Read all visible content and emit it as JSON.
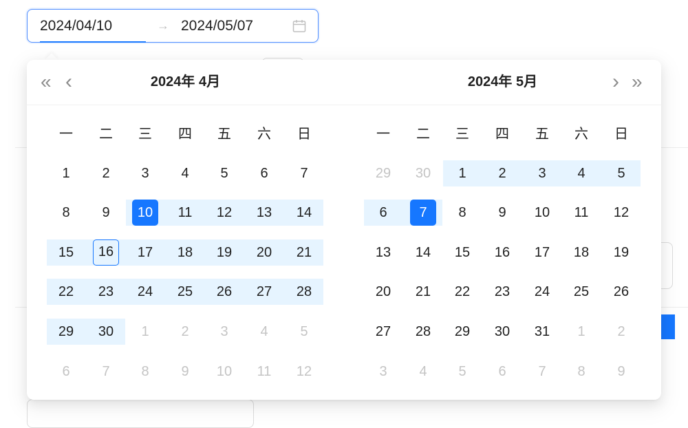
{
  "range": {
    "start": "2024/04/10",
    "separator": "→",
    "end": "2024/05/07"
  },
  "colors": {
    "accent": "#1677ff",
    "range_band": "#e6f4ff",
    "muted": "#c4c4c4"
  },
  "icons": {
    "calendar": "calendar-icon",
    "super_prev": "double-chevron-left-icon",
    "prev": "chevron-left-icon",
    "next": "chevron-right-icon",
    "super_next": "double-chevron-right-icon"
  },
  "nav": {
    "super_prev": "«",
    "prev": "‹",
    "next": "›",
    "super_next": "»"
  },
  "left_panel": {
    "title": "2024年  4月",
    "weekdays": [
      "一",
      "二",
      "三",
      "四",
      "五",
      "六",
      "日"
    ],
    "weeks": [
      [
        {
          "d": "1"
        },
        {
          "d": "2"
        },
        {
          "d": "3"
        },
        {
          "d": "4"
        },
        {
          "d": "5"
        },
        {
          "d": "6"
        },
        {
          "d": "7"
        }
      ],
      [
        {
          "d": "8"
        },
        {
          "d": "9"
        },
        {
          "d": "10",
          "s": "start"
        },
        {
          "d": "11",
          "r": 1
        },
        {
          "d": "12",
          "r": 1
        },
        {
          "d": "13",
          "r": 1
        },
        {
          "d": "14",
          "r": 1
        }
      ],
      [
        {
          "d": "15",
          "r": 1
        },
        {
          "d": "16",
          "r": 1,
          "s": "today"
        },
        {
          "d": "17",
          "r": 1
        },
        {
          "d": "18",
          "r": 1
        },
        {
          "d": "19",
          "r": 1
        },
        {
          "d": "20",
          "r": 1
        },
        {
          "d": "21",
          "r": 1
        }
      ],
      [
        {
          "d": "22",
          "r": 1
        },
        {
          "d": "23",
          "r": 1
        },
        {
          "d": "24",
          "r": 1
        },
        {
          "d": "25",
          "r": 1
        },
        {
          "d": "26",
          "r": 1
        },
        {
          "d": "27",
          "r": 1
        },
        {
          "d": "28",
          "r": 1
        }
      ],
      [
        {
          "d": "29",
          "r": 1
        },
        {
          "d": "30",
          "r": 1
        },
        {
          "d": "1",
          "o": 1
        },
        {
          "d": "2",
          "o": 1
        },
        {
          "d": "3",
          "o": 1
        },
        {
          "d": "4",
          "o": 1
        },
        {
          "d": "5",
          "o": 1
        }
      ],
      [
        {
          "d": "6",
          "o": 1
        },
        {
          "d": "7",
          "o": 1
        },
        {
          "d": "8",
          "o": 1
        },
        {
          "d": "9",
          "o": 1
        },
        {
          "d": "10",
          "o": 1
        },
        {
          "d": "11",
          "o": 1
        },
        {
          "d": "12",
          "o": 1
        }
      ]
    ]
  },
  "right_panel": {
    "title": "2024年  5月",
    "weekdays": [
      "一",
      "二",
      "三",
      "四",
      "五",
      "六",
      "日"
    ],
    "weeks": [
      [
        {
          "d": "29",
          "o": 1
        },
        {
          "d": "30",
          "o": 1
        },
        {
          "d": "1",
          "r": 1
        },
        {
          "d": "2",
          "r": 1
        },
        {
          "d": "3",
          "r": 1
        },
        {
          "d": "4",
          "r": 1
        },
        {
          "d": "5",
          "r": 1
        }
      ],
      [
        {
          "d": "6",
          "r": 1
        },
        {
          "d": "7",
          "s": "end"
        },
        {
          "d": "8"
        },
        {
          "d": "9"
        },
        {
          "d": "10"
        },
        {
          "d": "11"
        },
        {
          "d": "12"
        }
      ],
      [
        {
          "d": "13"
        },
        {
          "d": "14"
        },
        {
          "d": "15"
        },
        {
          "d": "16"
        },
        {
          "d": "17"
        },
        {
          "d": "18"
        },
        {
          "d": "19"
        }
      ],
      [
        {
          "d": "20"
        },
        {
          "d": "21"
        },
        {
          "d": "22"
        },
        {
          "d": "23"
        },
        {
          "d": "24"
        },
        {
          "d": "25"
        },
        {
          "d": "26"
        }
      ],
      [
        {
          "d": "27"
        },
        {
          "d": "28"
        },
        {
          "d": "29"
        },
        {
          "d": "30"
        },
        {
          "d": "31"
        },
        {
          "d": "1",
          "o": 1
        },
        {
          "d": "2",
          "o": 1
        }
      ],
      [
        {
          "d": "3",
          "o": 1
        },
        {
          "d": "4",
          "o": 1
        },
        {
          "d": "5",
          "o": 1
        },
        {
          "d": "6",
          "o": 1
        },
        {
          "d": "7",
          "o": 1
        },
        {
          "d": "8",
          "o": 1
        },
        {
          "d": "9",
          "o": 1
        }
      ]
    ]
  }
}
